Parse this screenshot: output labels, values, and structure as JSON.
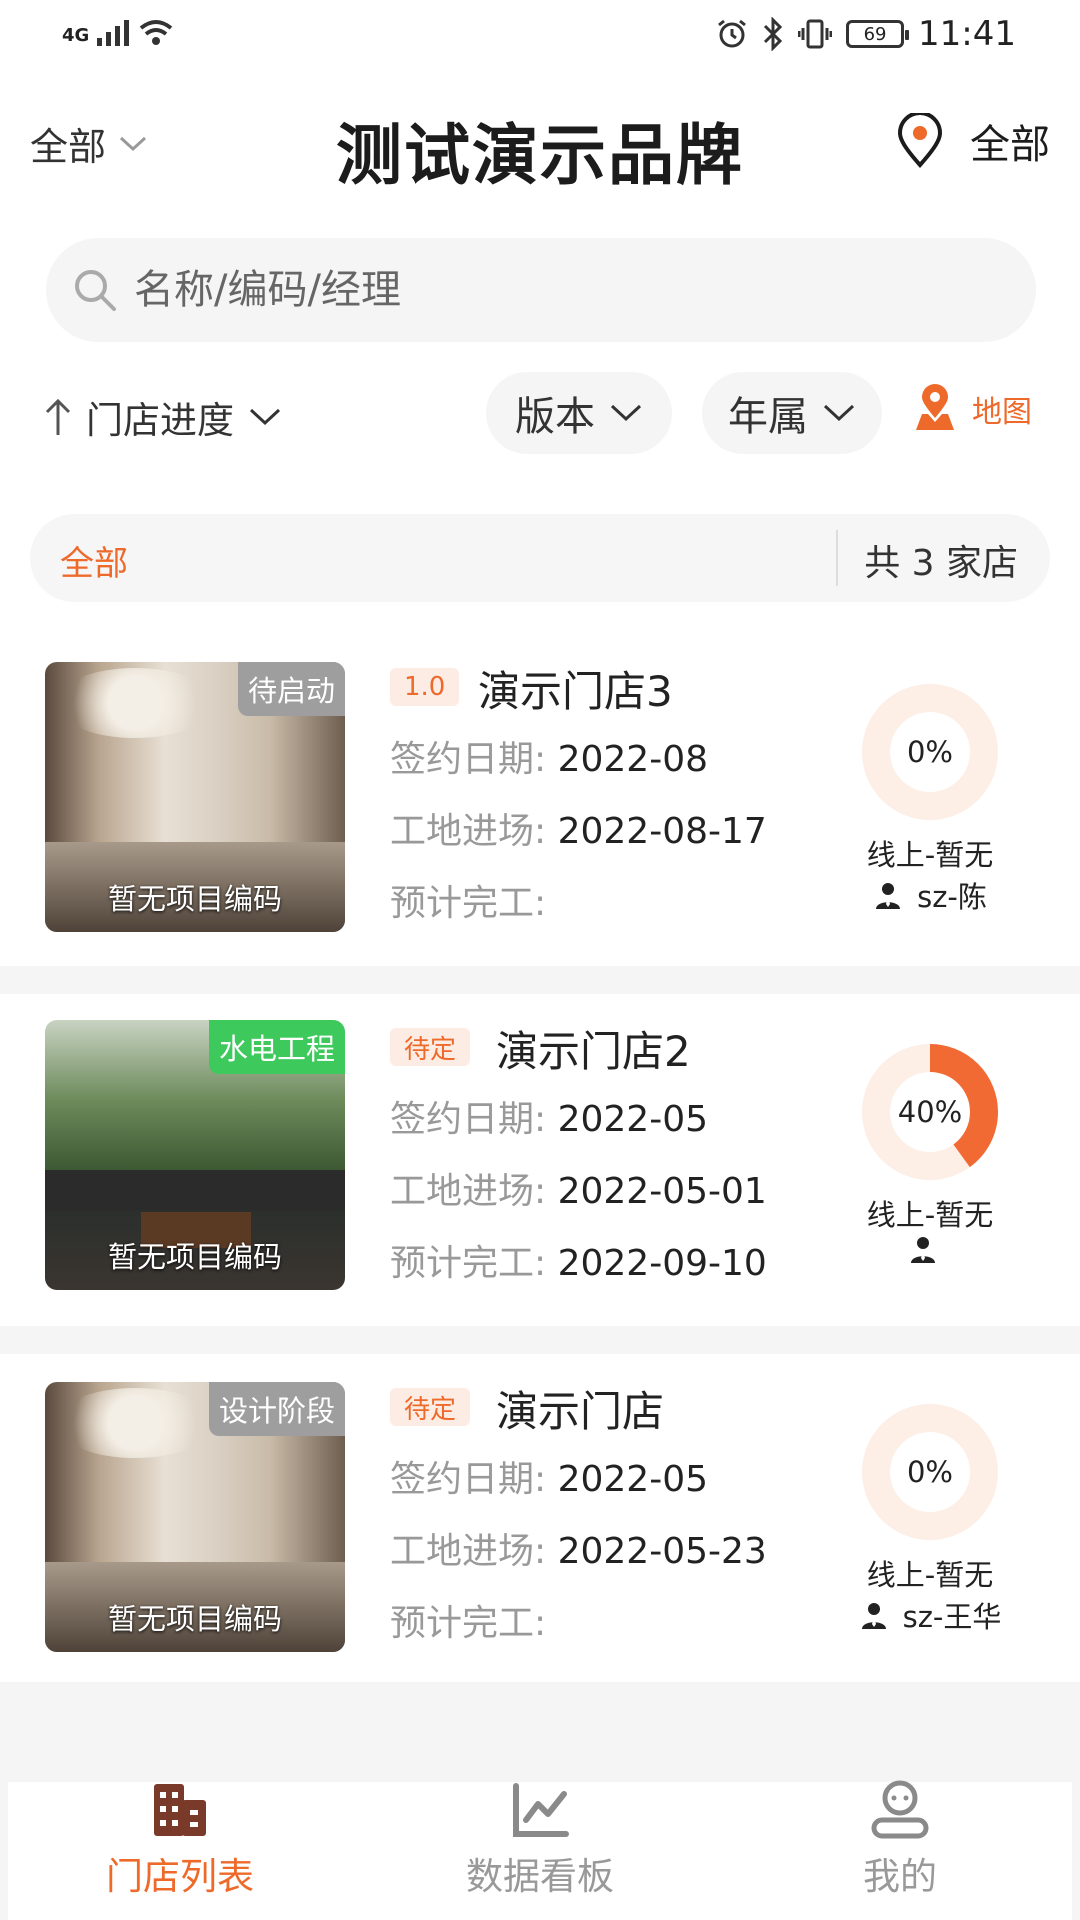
{
  "status_bar": {
    "network": "4G",
    "battery": "69",
    "time": "11:41"
  },
  "header": {
    "scope": "全部",
    "title": "测试演示品牌",
    "location": "全部"
  },
  "search": {
    "placeholder": "名称/编码/经理"
  },
  "filters": {
    "sort": "门店进度",
    "version": "版本",
    "year": "年属",
    "map": "地图"
  },
  "summary": {
    "filter": "全部",
    "count": "共 3 家店"
  },
  "field_labels": {
    "sign": "签约日期:",
    "enter": "工地进场:",
    "finish": "预计完工:"
  },
  "stores": [
    {
      "badge": "1.0",
      "name": "演示门店3",
      "stage": "待启动",
      "stage_color": "#9e9e9e",
      "code_text": "暂无项目编码",
      "sign_date": "2022-08",
      "enter_date": "2022-08-17",
      "finish_date": "",
      "progress": 0,
      "progress_label": "0%",
      "online": "线上-暂无",
      "manager": "sz-陈"
    },
    {
      "badge": "待定",
      "name": "演示门店2",
      "stage": "水电工程",
      "stage_color": "#3ec95c",
      "code_text": "暂无项目编码",
      "sign_date": "2022-05",
      "enter_date": "2022-05-01",
      "finish_date": "2022-09-10",
      "progress": 40,
      "progress_label": "40%",
      "online": "线上-暂无",
      "manager": ""
    },
    {
      "badge": "待定",
      "name": "演示门店",
      "stage": "设计阶段",
      "stage_color": "#9e9e9e",
      "code_text": "暂无项目编码",
      "sign_date": "2022-05",
      "enter_date": "2022-05-23",
      "finish_date": "",
      "progress": 0,
      "progress_label": "0%",
      "online": "线上-暂无",
      "manager": "sz-王华"
    }
  ],
  "tabs": [
    {
      "label": "门店列表",
      "active": true
    },
    {
      "label": "数据看板",
      "active": false
    },
    {
      "label": "我的",
      "active": false
    }
  ],
  "colors": {
    "accent": "#ee6a2b",
    "ring_bg": "#fdeee6",
    "ring_fill": "#f26a33"
  }
}
